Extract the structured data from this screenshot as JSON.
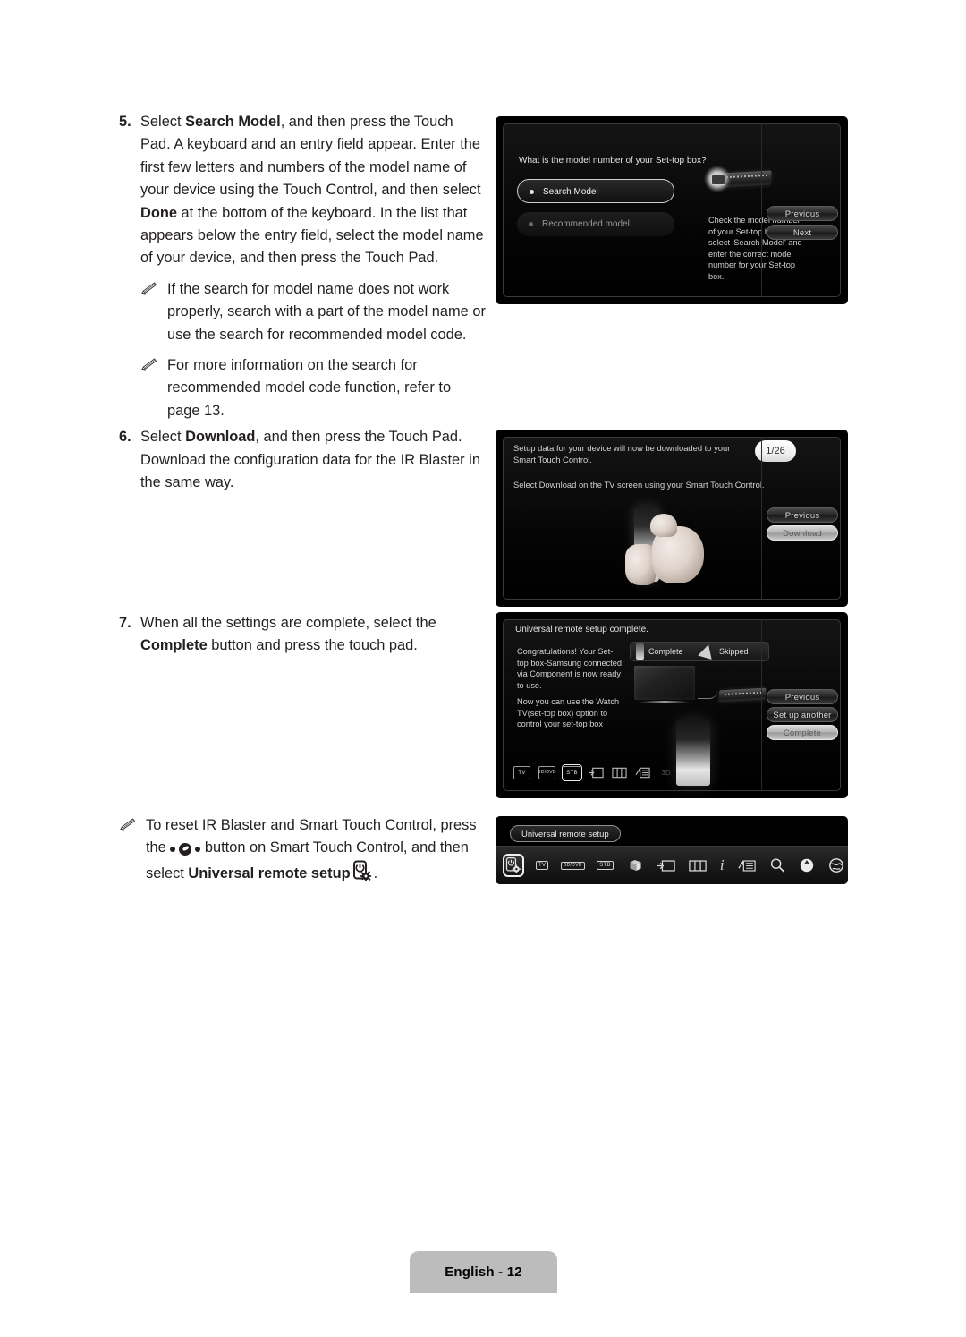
{
  "page": {
    "footer_label": "English - 12"
  },
  "instructions": {
    "step5": {
      "number": "5.",
      "parts": [
        {
          "t": "Select ",
          "b": false
        },
        {
          "t": "Search Model",
          "b": true
        },
        {
          "t": ", and then press the Touch Pad. A keyboard and an entry field appear. Enter the first few letters and numbers of the model name of your device using the Touch Control, and then select ",
          "b": false
        },
        {
          "t": "Done",
          "b": true
        },
        {
          "t": " at the bottom of the keyboard. In the list that appears below the entry field, select the model name of your device, and then press the Touch Pad.",
          "b": false
        }
      ]
    },
    "note1": "If the search for model name does not work properly, search with a part of the model name or use the search for recommended model code.",
    "note2": "For more information on the search for recommended model code function, refer to page 13.",
    "step6": {
      "number": "6.",
      "parts": [
        {
          "t": "Select ",
          "b": false
        },
        {
          "t": "Download",
          "b": true
        },
        {
          "t": ", and then press the Touch Pad. Download the configuration data for the IR Blaster in the same way.",
          "b": false
        }
      ]
    },
    "step7": {
      "number": "7.",
      "parts": [
        {
          "t": "When all the settings are complete, select the ",
          "b": false
        },
        {
          "t": "Complete",
          "b": true
        },
        {
          "t": " button and press the touch pad.",
          "b": false
        }
      ]
    },
    "note3": {
      "seg1": "To reset IR Blaster and Smart Touch Control, press the ",
      "seg2": " button on Smart Touch Control, and then select ",
      "seg3": "Universal remote setup",
      "seg4": "."
    }
  },
  "panel1": {
    "title": "What is the model number of your Set-top box?",
    "options": [
      {
        "label": "Search Model",
        "selected": true
      },
      {
        "label": "Recommended model",
        "selected": false
      }
    ],
    "help_text": "Check the model number of your Set-top box. Then select 'Search Model' and enter the correct model number for your Set-top box.",
    "buttons": [
      {
        "label": "Previous",
        "bright": false
      },
      {
        "label": "Next",
        "bright": false
      }
    ]
  },
  "panel2": {
    "line1": "Setup data for your device will now be downloaded to your Smart Touch Control.",
    "line2": "Select Download on the TV screen using your Smart Touch Control.",
    "page_badge": "1/26",
    "buttons": [
      {
        "label": "Previous",
        "bright": false
      },
      {
        "label": "Download",
        "bright": true
      }
    ]
  },
  "panel3": {
    "title": "Universal remote setup complete.",
    "status": [
      {
        "label": "Complete",
        "icon": "remote-icon"
      },
      {
        "label": "Skipped",
        "icon": "cone-icon"
      }
    ],
    "body1": "Congratulations! Your Set-top box-Samsung connected via Component is now ready to use.",
    "body2": "Now you can use the Watch TV(set-top box) option to control your set-top box",
    "buttons": [
      {
        "label": "Previous",
        "bright": false
      },
      {
        "label": "Set up another",
        "bright": false
      },
      {
        "label": "Complete",
        "bright": true
      }
    ],
    "icon_strip": [
      {
        "name": "tv-icon",
        "label": "TV",
        "selected": false,
        "dim": true
      },
      {
        "name": "bd-dvd-icon",
        "label": "BD/DVD",
        "selected": false,
        "dim": false
      },
      {
        "name": "stb-icon",
        "label": "STB",
        "selected": true,
        "dim": false
      },
      {
        "name": "source-icon",
        "label": "",
        "selected": false,
        "dim": false
      },
      {
        "name": "multiview-icon",
        "label": "",
        "selected": false,
        "dim": false
      },
      {
        "name": "schedule-icon",
        "label": "",
        "selected": false,
        "dim": false
      },
      {
        "name": "3d-icon",
        "label": "3D",
        "selected": false,
        "dim": true
      }
    ]
  },
  "panel4": {
    "tooltip": "Universal remote setup",
    "toolbar": [
      {
        "name": "universal-remote-setup-icon",
        "label": "",
        "selected": true
      },
      {
        "name": "tv-icon",
        "label": "TV",
        "selected": false
      },
      {
        "name": "bd-dvd-icon",
        "label": "BD/DVD",
        "selected": false
      },
      {
        "name": "stb-icon",
        "label": "STB",
        "selected": false
      },
      {
        "name": "sound-icon",
        "label": "",
        "selected": false
      },
      {
        "name": "source-icon",
        "label": "",
        "selected": false
      },
      {
        "name": "multiview-icon",
        "label": "",
        "selected": false
      },
      {
        "name": "info-icon",
        "label": "i",
        "selected": false
      },
      {
        "name": "schedule-icon",
        "label": "",
        "selected": false
      },
      {
        "name": "search-icon",
        "label": "",
        "selected": false
      },
      {
        "name": "apps-icon",
        "label": "",
        "selected": false
      },
      {
        "name": "web-browser-icon",
        "label": "",
        "selected": false
      },
      {
        "name": "help-icon",
        "label": "?",
        "selected": false
      }
    ]
  }
}
